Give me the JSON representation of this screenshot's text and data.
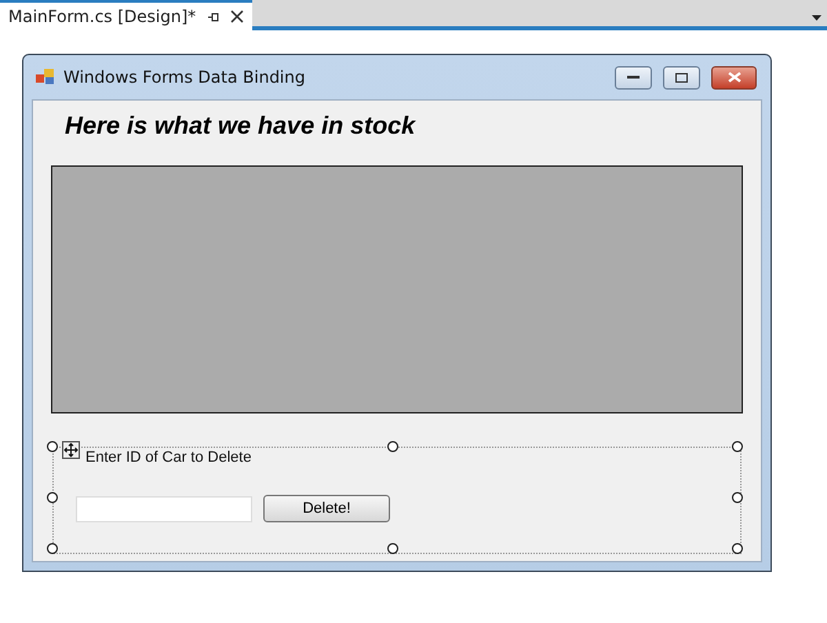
{
  "document_tab": {
    "title": "MainForm.cs [Design]*",
    "selected": true
  },
  "form": {
    "title": "Windows Forms Data Binding",
    "heading": "Here is what we have in stock",
    "group": {
      "label": "Enter ID of Car to Delete",
      "button": "Delete!"
    }
  }
}
